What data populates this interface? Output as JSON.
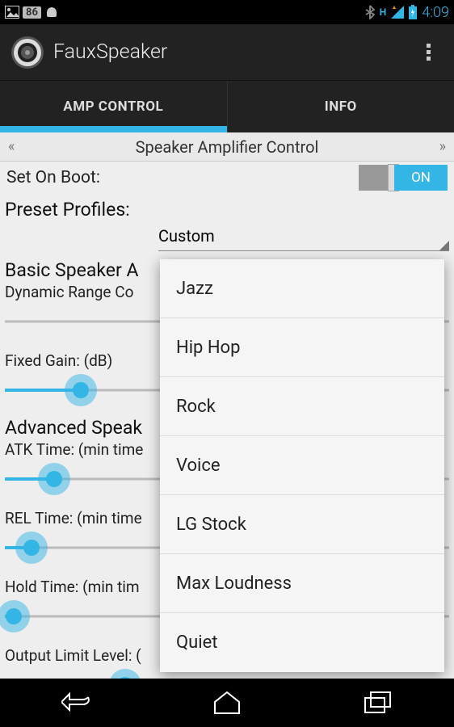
{
  "status_bar": {
    "battery_text": "86",
    "time": "4:09",
    "signal_label": "H"
  },
  "action_bar": {
    "title": "FauxSpeaker"
  },
  "tabs": [
    {
      "label": "AMP CONTROL",
      "selected": true
    },
    {
      "label": "INFO",
      "selected": false
    }
  ],
  "page": {
    "prev": "«",
    "next": "»",
    "title": "Speaker Amplifier Control",
    "set_on_boot_label": "Set On Boot:",
    "toggle_state": "ON",
    "preset_label": "Preset Profiles:",
    "preset_selected": "Custom",
    "dropdown_options": [
      "Jazz",
      "Hip Hop",
      "Rock",
      "Voice",
      "LG Stock",
      "Max Loudness",
      "Quiet"
    ],
    "basic_heading": "Basic Speaker A",
    "drc_label": "Dynamic Range Co",
    "fixed_gain_label": "Fixed Gain: (dB)",
    "advanced_heading": "Advanced Speak",
    "atk_label": "ATK Time: (min time",
    "rel_label": "REL Time: (min time",
    "hold_label": "Hold Time: (min tim",
    "output_limit_label": "Output Limit Level: (",
    "sliders": {
      "drc": 0,
      "fixed_gain": 17,
      "atk": 11,
      "rel": 6,
      "hold": 2,
      "output_limit": 27
    }
  }
}
